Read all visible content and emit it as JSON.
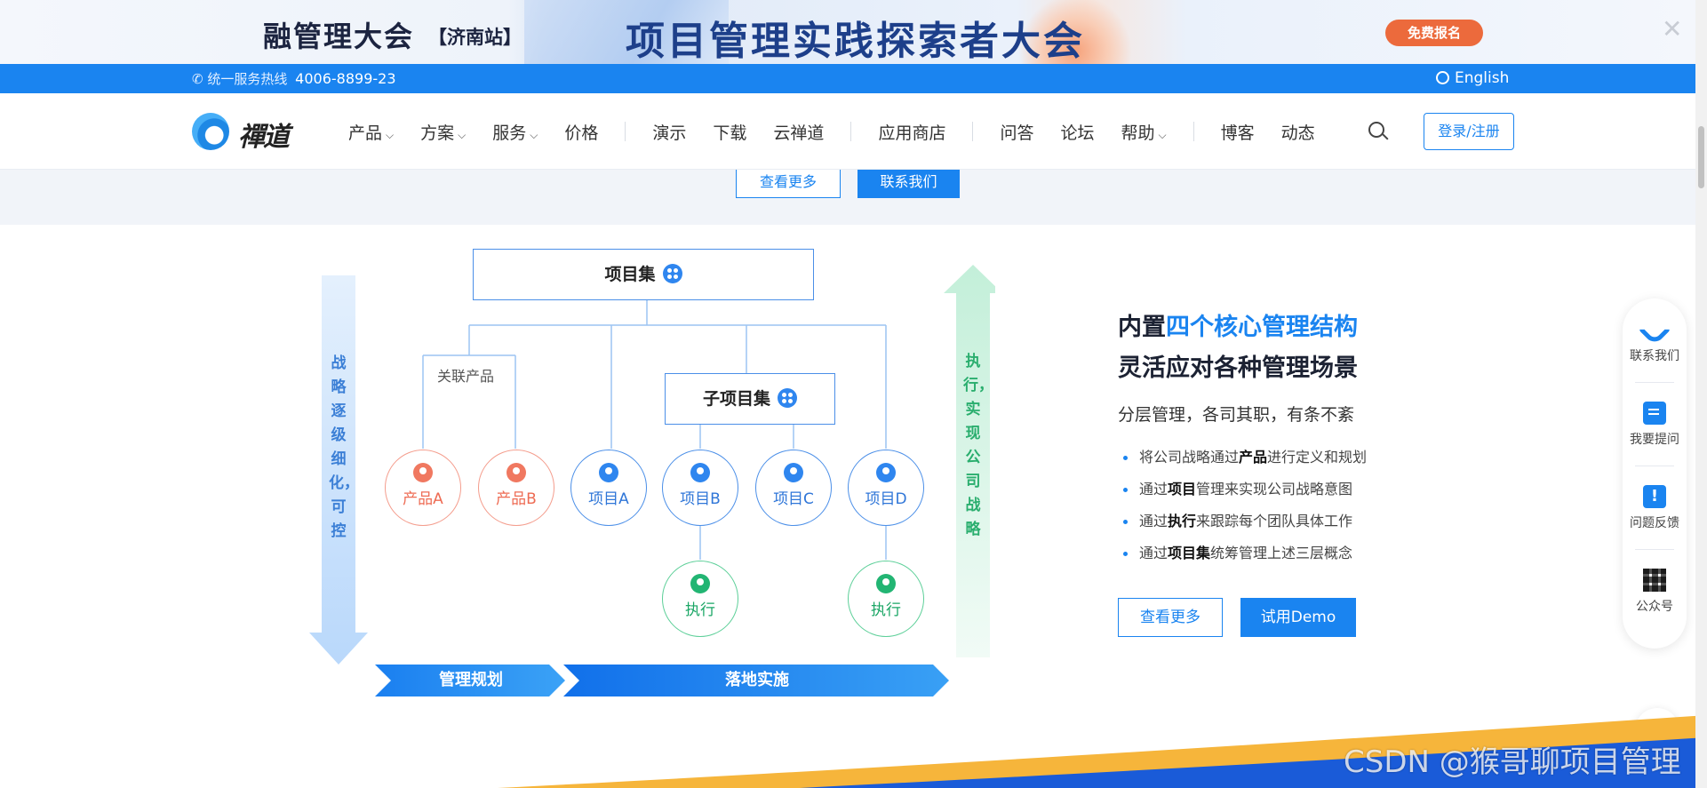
{
  "banner": {
    "left_title": "融管理大会",
    "left_sub": "【济南站】",
    "main_title": "项目管理实践探索者大会",
    "register_label": "免费报名",
    "close_label": "✕"
  },
  "topbar": {
    "hotline_label": "统一服务热线",
    "hotline_number": "4006-8899-23",
    "language": "English"
  },
  "nav": {
    "logo_text": "禪道",
    "items": [
      {
        "label": "产品",
        "has_menu": true
      },
      {
        "label": "方案",
        "has_menu": true
      },
      {
        "label": "服务",
        "has_menu": true
      },
      {
        "label": "价格"
      },
      {
        "label": "演示"
      },
      {
        "label": "下载"
      },
      {
        "label": "云禅道"
      },
      {
        "label": "应用商店"
      },
      {
        "label": "问答"
      },
      {
        "label": "论坛"
      },
      {
        "label": "帮助",
        "has_menu": true
      },
      {
        "label": "博客"
      },
      {
        "label": "动态"
      }
    ],
    "login_label": "登录/注册"
  },
  "prev_section": {
    "more_label": "查看更多",
    "contact_label": "联系我们"
  },
  "diagram": {
    "program_label": "项目集",
    "related_products_label": "关联产品",
    "sub_program_label": "子项目集",
    "products": [
      "产品A",
      "产品B"
    ],
    "projects": [
      "项目A",
      "项目B",
      "项目C",
      "项目D"
    ],
    "execution_label": "执行",
    "left_vertical": "战略逐级细化，可控",
    "right_vertical": "执行，实现公司战略",
    "ribbon_left": "管理规划",
    "ribbon_right": "落地实施"
  },
  "info": {
    "title_prefix": "内置",
    "title_highlight": "四个核心管理结构",
    "title_line2": "灵活应对各种管理场景",
    "subtitle": "分层管理，各司其职，有条不紊",
    "bullets": [
      {
        "pre": "将公司战略通过",
        "bold": "产品",
        "post": "进行定义和规划"
      },
      {
        "pre": "通过",
        "bold": "项目",
        "post": "管理来实现公司战略意图"
      },
      {
        "pre": "通过",
        "bold": "执行",
        "post": "来跟踪每个团队具体工作"
      },
      {
        "pre": "通过",
        "bold": "项目集",
        "post": "统筹管理上述三层概念"
      }
    ],
    "more_label": "查看更多",
    "demo_label": "试用Demo"
  },
  "sidebar": {
    "items": [
      {
        "label": "联系我们",
        "icon": "phone-icon"
      },
      {
        "label": "我要提问",
        "icon": "edit-icon"
      },
      {
        "label": "问题反馈",
        "icon": "alert-icon"
      },
      {
        "label": "公众号",
        "icon": "qr-code-icon"
      }
    ]
  },
  "watermark": "CSDN @猴哥聊项目管理",
  "colors": {
    "primary": "#1a84f0",
    "product": "#ee6b53",
    "execution": "#22b573",
    "banner_button": "#ec6a3c"
  }
}
